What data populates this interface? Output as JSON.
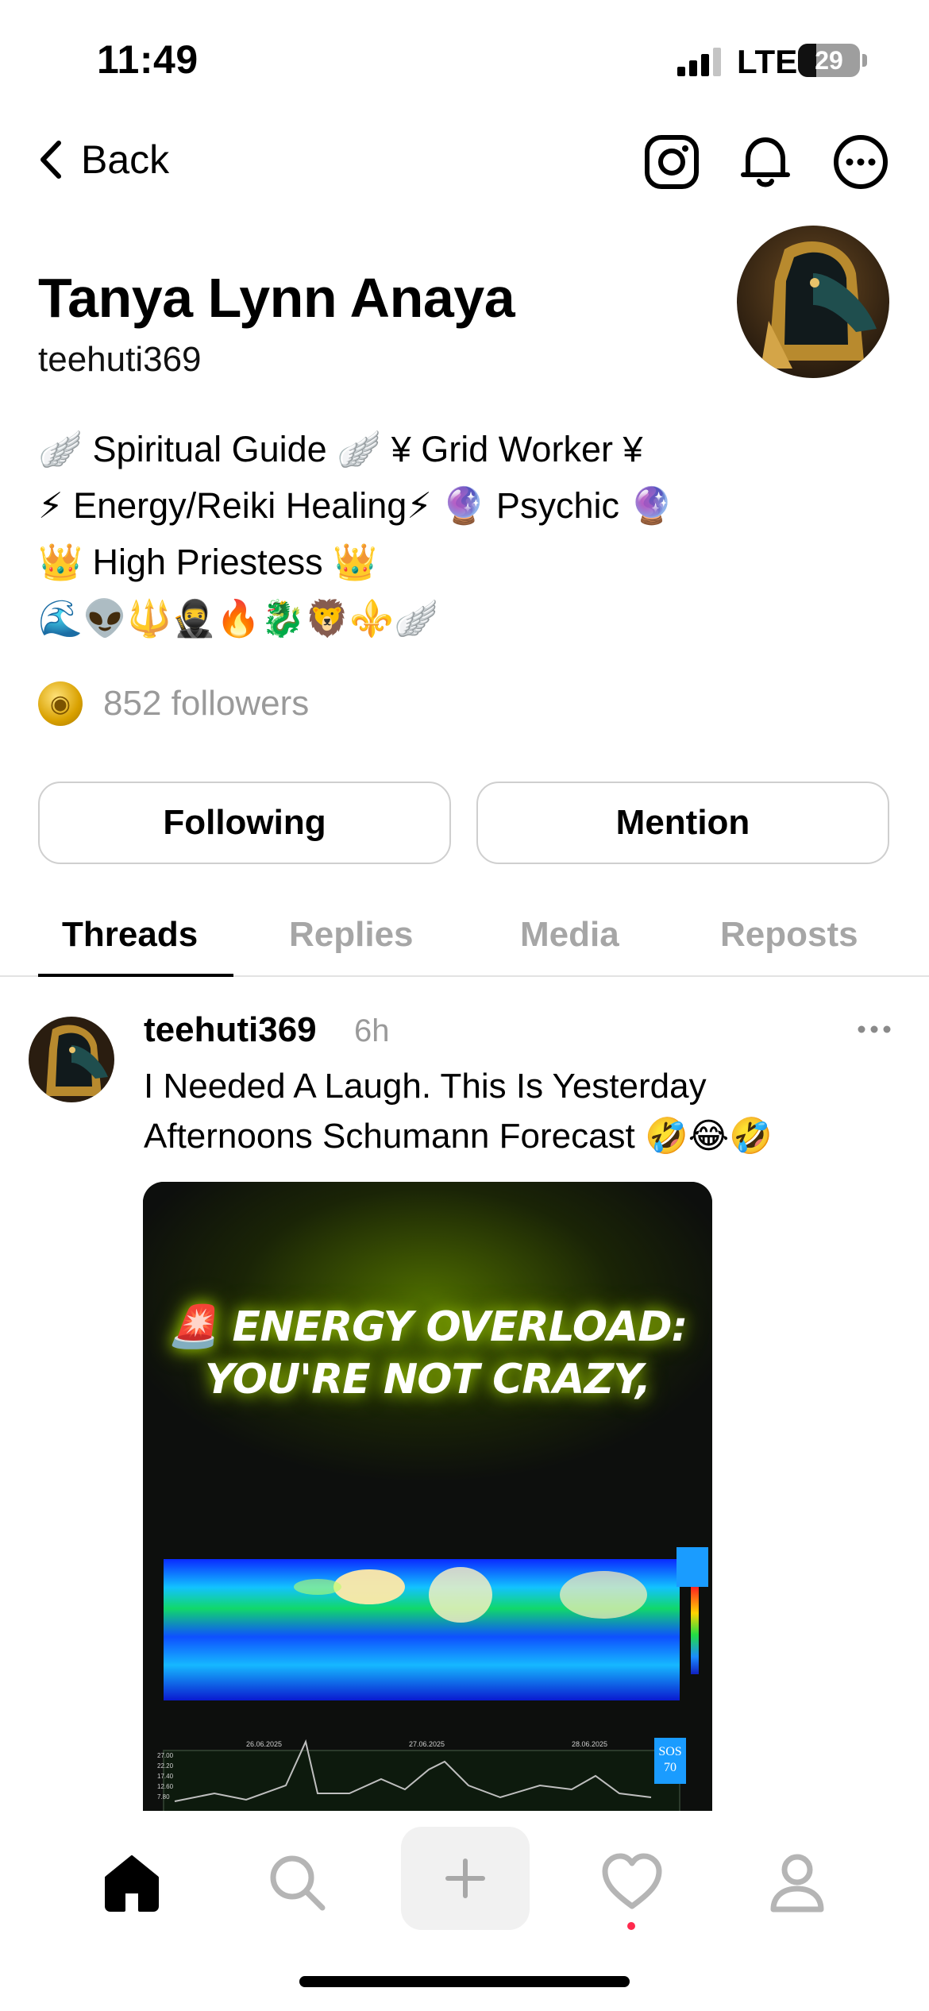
{
  "status_bar": {
    "time": "11:49",
    "network": "LTE",
    "battery": "29",
    "battery_level_percent": 29
  },
  "nav": {
    "back_label": "Back",
    "icons": [
      "instagram-icon",
      "bell-icon",
      "more-icon"
    ]
  },
  "profile": {
    "name": "Tanya Lynn Anaya",
    "handle": "teehuti369",
    "bio_lines": [
      "🪽 Spiritual Guide 🪽 ¥ Grid Worker ¥",
      "⚡ Energy/Reiki Healing⚡ 🔮 Psychic 🔮",
      "👑 High Priestess 👑",
      "🌊👽🔱🥷🔥🐉🦁⚜️🪽"
    ],
    "followers": "852 followers"
  },
  "buttons": {
    "following": "Following",
    "mention": "Mention"
  },
  "tabs": [
    {
      "label": "Threads",
      "active": true
    },
    {
      "label": "Replies",
      "active": false
    },
    {
      "label": "Media",
      "active": false
    },
    {
      "label": "Reposts",
      "active": false
    }
  ],
  "post": {
    "handle": "teehuti369",
    "time": "6h",
    "text": "I Needed A Laugh. This Is Yesterday Afternoons Schumann Forecast 🤣😂🤣",
    "media": {
      "headline": "🚨 ENERGY OVERLOAD: YOU'RE NOT CRAZY,",
      "chart_dates": [
        "26.06.2025",
        "27.06.2025",
        "28.06.2025"
      ],
      "chart_y_ticks": [
        "27.00",
        "22.20",
        "17.40",
        "12.60",
        "7.80"
      ],
      "badge": "SOS 70"
    }
  },
  "bottom_bar": {
    "icons": [
      "home-icon",
      "search-icon",
      "plus-icon",
      "heart-icon",
      "profile-icon"
    ],
    "activity_dot_color": "#ff2a4d"
  }
}
